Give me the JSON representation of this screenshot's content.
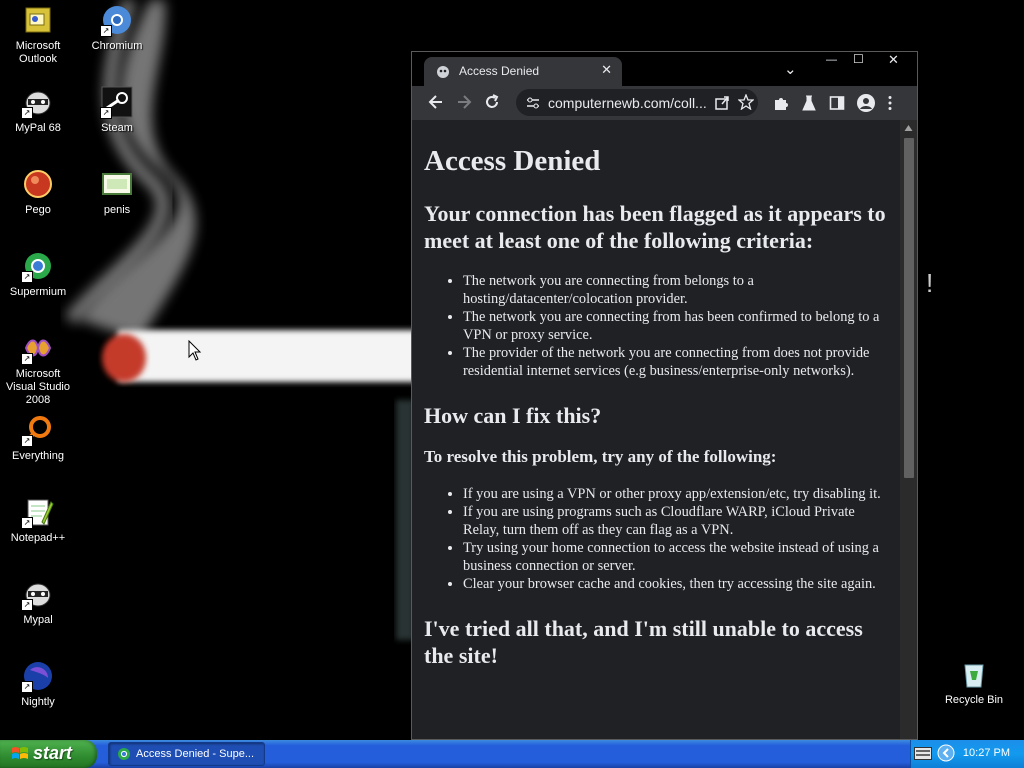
{
  "desktop": {
    "icons": [
      {
        "label": "Microsoft Outlook"
      },
      {
        "label": "MyPal 68"
      },
      {
        "label": "Pego"
      },
      {
        "label": "Supermium"
      },
      {
        "label": "Microsoft Visual Studio 2008"
      },
      {
        "label": "Everything"
      },
      {
        "label": "Notepad++"
      },
      {
        "label": "Mypal"
      },
      {
        "label": "Nightly"
      },
      {
        "label": "Chromium"
      },
      {
        "label": "Steam"
      },
      {
        "label": "penis"
      },
      {
        "label": "Recycle Bin"
      }
    ]
  },
  "browser": {
    "tab": {
      "title": "Access Denied",
      "close": "✕"
    },
    "window_controls": {
      "tab_list": "⌄",
      "minimize": "—",
      "maximize": "☐",
      "close": "✕"
    },
    "address": "computernewb.com/coll..."
  },
  "page": {
    "h1": "Access Denied",
    "h2_flagged": "Your connection has been flagged as it appears to meet at least one of the following criteria:",
    "criteria": [
      "The network you are connecting from belongs to a hosting/datacenter/colocation provider.",
      "The network you are connecting from has been confirmed to belong to a VPN or proxy service.",
      "The provider of the network you are connecting from does not provide residential internet services (e.g business/enterprise-only networks)."
    ],
    "h2_fix": "How can I fix this?",
    "h3_resolve": "To resolve this problem, try any of the following:",
    "fixes": [
      "If you are using a VPN or other proxy app/extension/etc, try disabling it.",
      "If you are using programs such as Cloudflare WARP, iCloud Private Relay, turn them off as they can flag as a VPN.",
      "Try using your home connection to access the website instead of using a business connection or server.",
      "Clear your browser cache and cookies, then try accessing the site again."
    ],
    "h2_tried": "I've tried all that, and I'm still unable to access the site!"
  },
  "taskbar": {
    "start_label": "start",
    "task_label": "Access Denied - Supe...",
    "clock": "10:27 PM"
  }
}
